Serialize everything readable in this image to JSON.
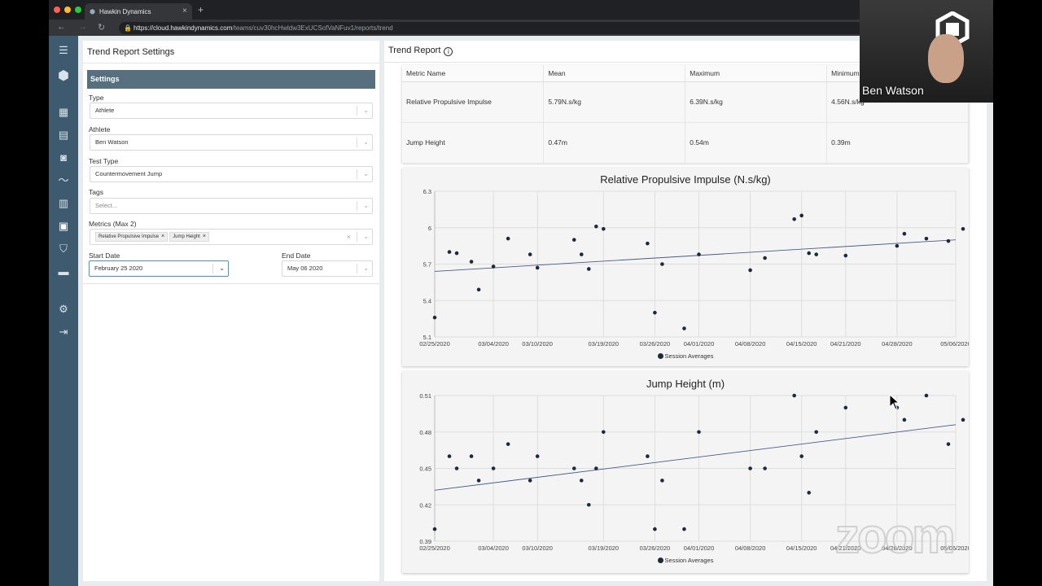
{
  "browser": {
    "tab_title": "Hawkin Dynamics",
    "url_host": "https://cloud.hawkindynamics.com",
    "url_path": "/teams/cuv30hcHwldw3ExUCSofVaNFuv1/reports/trend"
  },
  "left_panel": {
    "title": "Trend Report Settings",
    "settings_header": "Settings",
    "type_label": "Type",
    "type_value": "Athlete",
    "athlete_label": "Athlete",
    "athlete_value": "Ben Watson",
    "test_type_label": "Test Type",
    "test_type_value": "Countermovement Jump",
    "tags_label": "Tags",
    "tags_placeholder": "Select...",
    "metrics_label": "Metrics (Max 2)",
    "metrics_chips": [
      "Relative Propulsive Impulse",
      "Jump Height"
    ],
    "start_date_label": "Start Date",
    "start_date_value": "February 25 2020",
    "end_date_label": "End Date",
    "end_date_value": "May 06 2020"
  },
  "right_panel": {
    "title": "Trend Report",
    "table": {
      "headers": [
        "Metric Name",
        "Mean",
        "Maximum",
        "Minimum"
      ],
      "rows": [
        [
          "Relative Propulsive Impulse",
          "5.79N.s/kg",
          "6.39N.s/kg",
          "4.56N.s/kg"
        ],
        [
          "Jump Height",
          "0.47m",
          "0.54m",
          "0.39m"
        ]
      ]
    }
  },
  "video": {
    "participant_name": "Ben Watson",
    "watermark": "zoom"
  },
  "colors": {
    "sidebar": "#3d5a6e",
    "settings_header": "#56707f",
    "point": "#1e2a3a",
    "trend_line": "#4a5a8a"
  },
  "chart_data": [
    {
      "type": "scatter",
      "title": "Relative Propulsive Impulse (N.s/kg)",
      "legend": [
        "Session Averages"
      ],
      "legend_position": "bottom",
      "grid": true,
      "ylim": [
        5.1,
        6.3
      ],
      "yticks": [
        5.1,
        5.4,
        5.7,
        6,
        6.3
      ],
      "xticks": [
        "02/25/2020",
        "03/04/2020",
        "03/10/2020",
        "03/19/2020",
        "03/26/2020",
        "04/01/2020",
        "04/08/2020",
        "04/15/2020",
        "04/21/2020",
        "04/28/2020",
        "05/06/2020"
      ],
      "xlim": [
        "2020-02-25",
        "2020-05-06"
      ],
      "trendline": [
        [
          "2020-02-25",
          5.64
        ],
        [
          "2020-05-06",
          5.9
        ]
      ],
      "points": [
        [
          "2020-02-25",
          5.26
        ],
        [
          "2020-02-27",
          5.8
        ],
        [
          "2020-02-28",
          5.79
        ],
        [
          "2020-03-01",
          5.72
        ],
        [
          "2020-03-02",
          5.49
        ],
        [
          "2020-03-04",
          5.68
        ],
        [
          "2020-03-06",
          5.91
        ],
        [
          "2020-03-09",
          5.78
        ],
        [
          "2020-03-10",
          5.67
        ],
        [
          "2020-03-15",
          5.9
        ],
        [
          "2020-03-16",
          5.78
        ],
        [
          "2020-03-17",
          5.66
        ],
        [
          "2020-03-18",
          6.01
        ],
        [
          "2020-03-19",
          5.99
        ],
        [
          "2020-03-25",
          5.87
        ],
        [
          "2020-03-26",
          5.3
        ],
        [
          "2020-03-27",
          5.7
        ],
        [
          "2020-03-30",
          5.17
        ],
        [
          "2020-04-01",
          5.78
        ],
        [
          "2020-04-08",
          5.65
        ],
        [
          "2020-04-10",
          5.75
        ],
        [
          "2020-04-14",
          6.07
        ],
        [
          "2020-04-15",
          6.1
        ],
        [
          "2020-04-16",
          5.79
        ],
        [
          "2020-04-17",
          5.78
        ],
        [
          "2020-04-21",
          5.77
        ],
        [
          "2020-04-28",
          5.85
        ],
        [
          "2020-04-29",
          5.95
        ],
        [
          "2020-05-02",
          5.91
        ],
        [
          "2020-05-05",
          5.89
        ],
        [
          "2020-05-07",
          5.99
        ]
      ]
    },
    {
      "type": "scatter",
      "title": "Jump Height (m)",
      "legend": [
        "Session Averages"
      ],
      "legend_position": "bottom",
      "grid": true,
      "ylim": [
        0.39,
        0.51
      ],
      "yticks": [
        0.39,
        0.42,
        0.45,
        0.48,
        0.51
      ],
      "xticks": [
        "02/25/2020",
        "03/04/2020",
        "03/10/2020",
        "03/19/2020",
        "03/26/2020",
        "04/01/2020",
        "04/08/2020",
        "04/15/2020",
        "04/21/2020",
        "04/28/2020",
        "05/06/2020"
      ],
      "xlim": [
        "2020-02-25",
        "2020-05-06"
      ],
      "trendline": [
        [
          "2020-02-25",
          0.432
        ],
        [
          "2020-05-06",
          0.486
        ]
      ],
      "points": [
        [
          "2020-02-25",
          0.4
        ],
        [
          "2020-02-27",
          0.46
        ],
        [
          "2020-02-28",
          0.45
        ],
        [
          "2020-03-01",
          0.46
        ],
        [
          "2020-03-02",
          0.44
        ],
        [
          "2020-03-04",
          0.45
        ],
        [
          "2020-03-06",
          0.47
        ],
        [
          "2020-03-09",
          0.44
        ],
        [
          "2020-03-10",
          0.46
        ],
        [
          "2020-03-15",
          0.45
        ],
        [
          "2020-03-16",
          0.44
        ],
        [
          "2020-03-17",
          0.42
        ],
        [
          "2020-03-18",
          0.45
        ],
        [
          "2020-03-19",
          0.48
        ],
        [
          "2020-03-25",
          0.46
        ],
        [
          "2020-03-26",
          0.4
        ],
        [
          "2020-03-27",
          0.44
        ],
        [
          "2020-03-30",
          0.4
        ],
        [
          "2020-04-01",
          0.48
        ],
        [
          "2020-04-08",
          0.45
        ],
        [
          "2020-04-10",
          0.45
        ],
        [
          "2020-04-14",
          0.51
        ],
        [
          "2020-04-15",
          0.46
        ],
        [
          "2020-04-16",
          0.43
        ],
        [
          "2020-04-17",
          0.48
        ],
        [
          "2020-04-21",
          0.5
        ],
        [
          "2020-04-28",
          0.5
        ],
        [
          "2020-04-29",
          0.49
        ],
        [
          "2020-05-02",
          0.51
        ],
        [
          "2020-05-05",
          0.47
        ],
        [
          "2020-05-07",
          0.49
        ]
      ]
    }
  ]
}
